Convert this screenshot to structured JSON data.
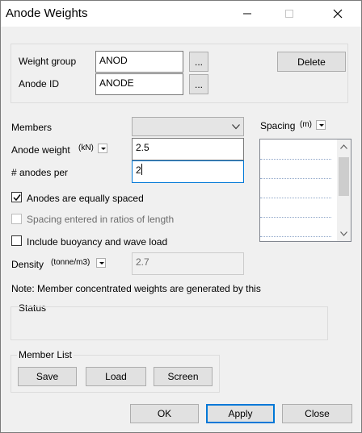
{
  "window": {
    "title": "Anode Weights"
  },
  "weight_group": {
    "label": "Weight group",
    "value": "ANOD",
    "browse_label": "..."
  },
  "anode_id": {
    "label": "Anode ID",
    "value": "ANODE",
    "browse_label": "..."
  },
  "delete_label": "Delete",
  "members": {
    "label": "Members",
    "value": ""
  },
  "spacing": {
    "label": "Spacing",
    "unit": "(m)"
  },
  "anode_weight": {
    "label": "Anode weight",
    "unit": "(kN)",
    "value": "2.5"
  },
  "anodes_per": {
    "label": "# anodes per",
    "value": "2"
  },
  "checkboxes": {
    "equally_spaced": {
      "label": "Anodes are equally spaced",
      "checked": true
    },
    "ratios": {
      "label": "Spacing entered in ratios of length",
      "checked": false,
      "disabled": true
    },
    "buoyancy": {
      "label": "Include buoyancy and wave load",
      "checked": false
    }
  },
  "density": {
    "label": "Density",
    "unit": "(tonne/m3)",
    "value": "2.7"
  },
  "note": "Note: Member concentrated weights are generated by this",
  "status": {
    "label": "Status",
    "value": ""
  },
  "member_list": {
    "label": "Member List",
    "save": "Save",
    "load": "Load",
    "screen": "Screen"
  },
  "footer": {
    "ok": "OK",
    "apply": "Apply",
    "close": "Close"
  }
}
